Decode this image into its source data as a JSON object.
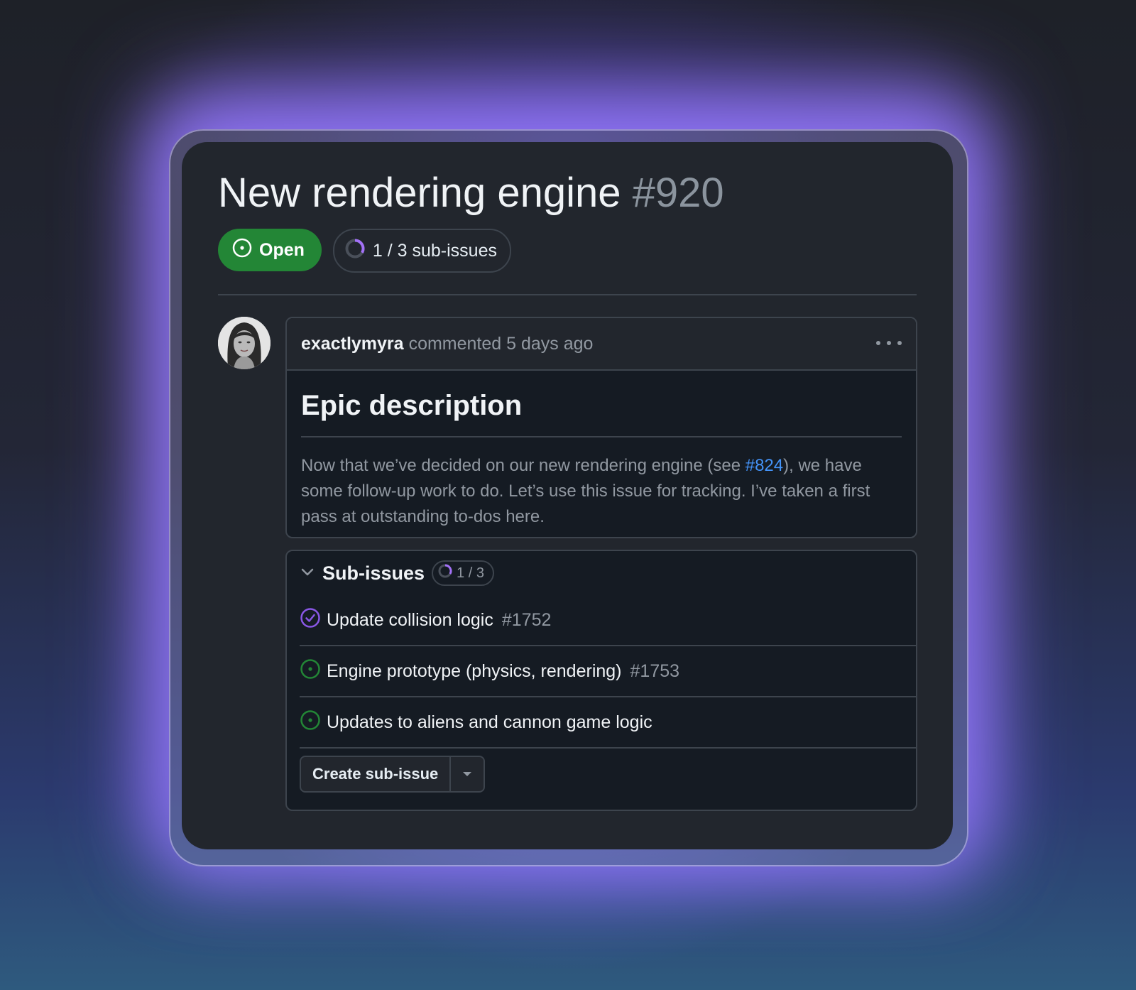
{
  "issue": {
    "title": "New rendering engine",
    "number": "#920",
    "state_label": "Open",
    "subissues_summary": "1 / 3 sub-issues"
  },
  "comment": {
    "author": "exactlymyra",
    "meta": "commented 5 days ago",
    "heading": "Epic description",
    "body_before": "Now that we’ve decided on our new rendering engine (see ",
    "body_link": "#824",
    "body_after": "), we have some follow-up work to do. Let’s use this issue for tracking. I’ve taken a first pass at outstanding to-dos here."
  },
  "subissues": {
    "title": "Sub-issues",
    "count": "1 / 3",
    "progress": 0.333,
    "items": [
      {
        "label": "Update collision logic",
        "number": "#1752",
        "state": "closed"
      },
      {
        "label": "Engine prototype (physics, rendering)",
        "number": "#1753",
        "state": "open"
      },
      {
        "label": "Updates to aliens and cannon game logic",
        "number": "",
        "state": "open"
      }
    ],
    "create_button": "Create sub-issue"
  },
  "colors": {
    "open_green": "#238636",
    "done_purple": "#8957e5",
    "link_blue": "#4493f8",
    "card_bg": "#22262d"
  }
}
